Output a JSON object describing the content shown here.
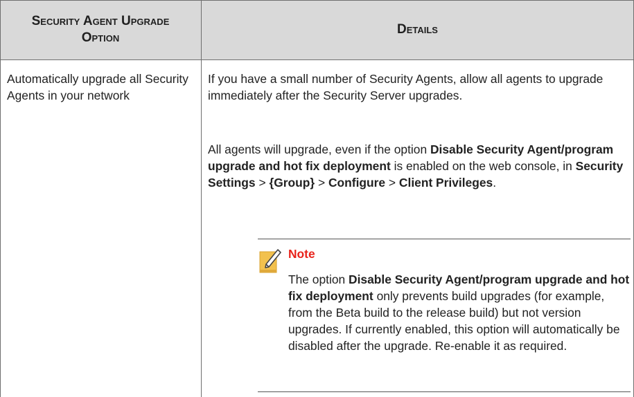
{
  "table": {
    "headers": [
      "Security Agent Upgrade Option",
      "Details"
    ],
    "row": {
      "option": "Automatically upgrade all Security Agents in your network",
      "para1": "If you have a small number of Security Agents, allow all agents to upgrade immediately after the Security Server upgrades.",
      "para2": {
        "t1": "All agents will upgrade, even if the option ",
        "b1": "Disable Security Agent/program upgrade and hot fix deployment",
        "t2": " is enabled on the web console, in ",
        "b2": "Security Settings",
        "t3": " > ",
        "b3": "{Group}",
        "t4": " > ",
        "b4": "Configure",
        "t5": " > ",
        "b5": "Client Privileges",
        "t6": "."
      },
      "note": {
        "title": "Note",
        "t1": "The option ",
        "b1": "Disable Security Agent/program upgrade and hot fix deployment",
        "t2": " only prevents build upgrades (for example, from the Beta build to the release build) but not version upgrades. If currently enabled, this option will automatically be disabled after the upgrade. Re-enable it as required."
      }
    }
  },
  "colors": {
    "header_bg": "#d9d9d9",
    "note_title": "#e8231b",
    "note_icon": "#f2c14e"
  },
  "icons": {
    "note": "note-pencil-icon"
  }
}
